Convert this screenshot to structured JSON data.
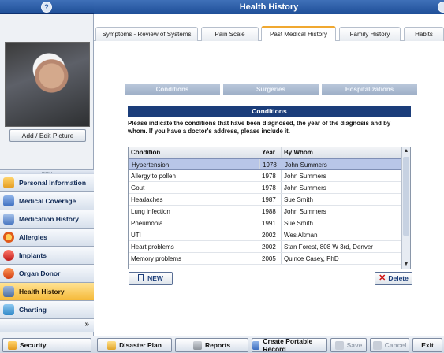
{
  "window": {
    "title": "Health History",
    "help_icon": "?"
  },
  "left_panel": {
    "add_picture_label": "Add / Edit Picture",
    "nav_items": [
      {
        "label": "Personal Information",
        "icon": "person-icon"
      },
      {
        "label": "Medical Coverage",
        "icon": "coverage-icon"
      },
      {
        "label": "Medication History",
        "icon": "medication-icon"
      },
      {
        "label": "Allergies",
        "icon": "allergy-icon"
      },
      {
        "label": "Implants",
        "icon": "implant-icon"
      },
      {
        "label": "Organ Donor",
        "icon": "organ-icon"
      },
      {
        "label": "Health History",
        "icon": "stethoscope-icon"
      },
      {
        "label": "Charting",
        "icon": "chart-icon"
      }
    ],
    "more_label": "»"
  },
  "tabs": [
    {
      "label": "Symptoms - Review of Systems"
    },
    {
      "label": "Pain Scale"
    },
    {
      "label": "Past Medical History"
    },
    {
      "label": "Family History"
    },
    {
      "label": "Habits"
    }
  ],
  "subtabs": [
    "Conditions",
    "Surgeries",
    "Hospitalizations"
  ],
  "section": {
    "title": "Conditions",
    "instructions": "Please indicate the conditions that have been diagnosed, the year of the diagnosis and by whom.  If you have a doctor's address, please include it."
  },
  "table": {
    "headers": [
      "Condition",
      "Year",
      "By Whom"
    ],
    "rows": [
      [
        "Hypertension",
        "1978",
        "John Summers"
      ],
      [
        "Allergy to pollen",
        "1978",
        "John Summers"
      ],
      [
        "Gout",
        "1978",
        "John Summers"
      ],
      [
        "Headaches",
        "1987",
        "Sue Smith"
      ],
      [
        "Lung infection",
        "1988",
        "John Summers"
      ],
      [
        "Pneumonia",
        "1991",
        "Sue Smith"
      ],
      [
        "UTI",
        "2002",
        "Wes Altman"
      ],
      [
        "Heart problems",
        "2002",
        "Stan Forest, 808 W 3rd, Denver"
      ],
      [
        "Memory problems",
        "2005",
        "Quince Casey, PhD"
      ]
    ]
  },
  "actions": {
    "new_label": "NEW",
    "delete_label": "Delete"
  },
  "bottom_bar": {
    "security": "Security",
    "disaster_plan": "Disaster Plan",
    "reports": "Reports",
    "portable_record": "Create Portable Record",
    "save": "Save",
    "cancel": "Cancel",
    "exit": "Exit"
  }
}
